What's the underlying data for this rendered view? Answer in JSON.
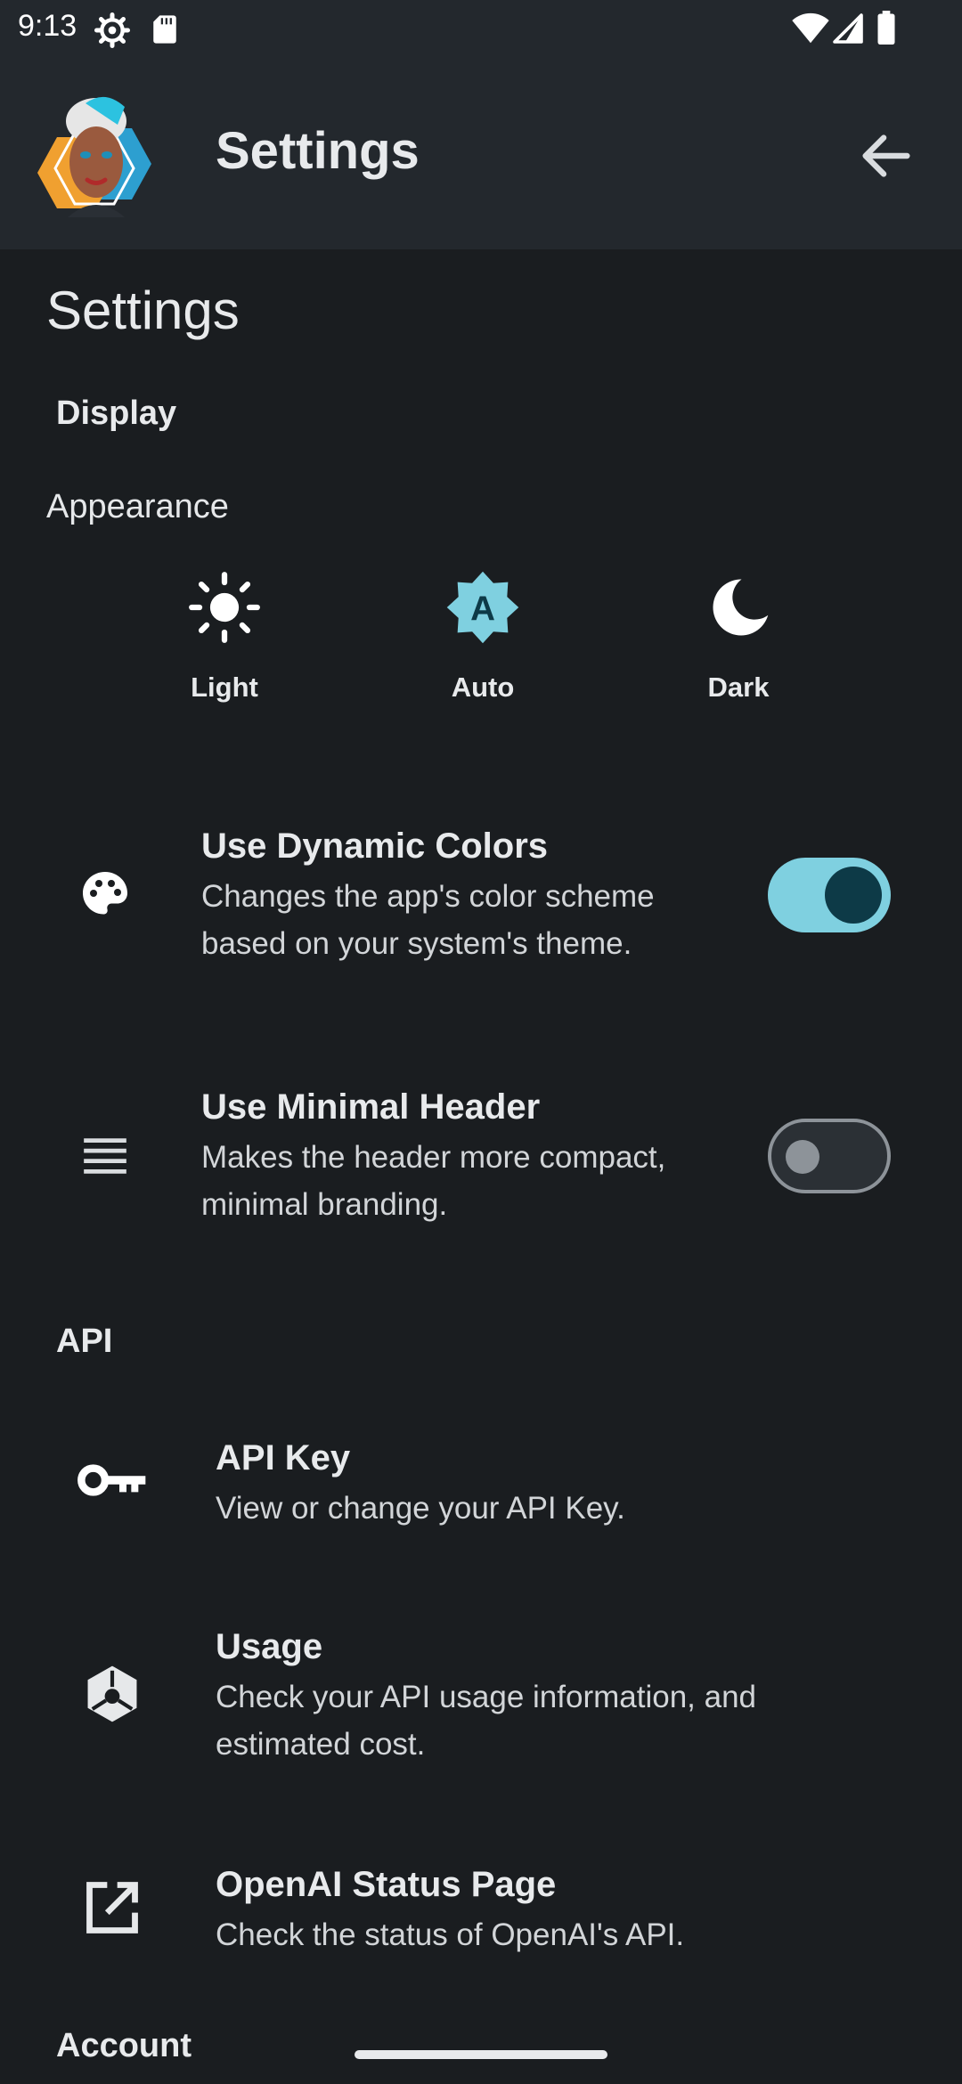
{
  "status_bar": {
    "time": "9:13",
    "icons": [
      "gear-icon",
      "sd-card-icon",
      "wifi-icon",
      "signal-icon",
      "battery-icon"
    ]
  },
  "app_bar": {
    "title": "Settings",
    "avatar": "app-avatar",
    "back_icon": "arrow-back-icon"
  },
  "page": {
    "title": "Settings"
  },
  "display": {
    "section_label": "Display",
    "appearance": {
      "label": "Appearance",
      "options": [
        {
          "label": "Light",
          "icon": "sun-icon"
        },
        {
          "label": "Auto",
          "icon": "auto-brightness-icon",
          "selected": true
        },
        {
          "label": "Dark",
          "icon": "moon-icon"
        }
      ]
    },
    "dynamic_colors": {
      "title": "Use Dynamic Colors",
      "description": "Changes the app's color scheme based on your system's theme.",
      "icon": "palette-icon",
      "enabled": true
    },
    "minimal_header": {
      "title": "Use Minimal Header",
      "description": "Makes the header more compact, minimal branding.",
      "icon": "lines-icon",
      "enabled": false
    }
  },
  "api": {
    "section_label": "API",
    "items": [
      {
        "title": "API Key",
        "description": "View or change your API Key.",
        "icon": "key-icon"
      },
      {
        "title": "Usage",
        "description": "Check your API usage information, and estimated cost.",
        "icon": "usage-cube-icon"
      },
      {
        "title": "OpenAI Status Page",
        "description": "Check the status of OpenAI's API.",
        "icon": "open-external-icon"
      }
    ]
  },
  "account": {
    "section_label": "Account"
  },
  "colors": {
    "background": "#1a1d20",
    "header": "#23282d",
    "accent": "#7fd0e0",
    "switch_knob_on": "#0d3a47"
  }
}
